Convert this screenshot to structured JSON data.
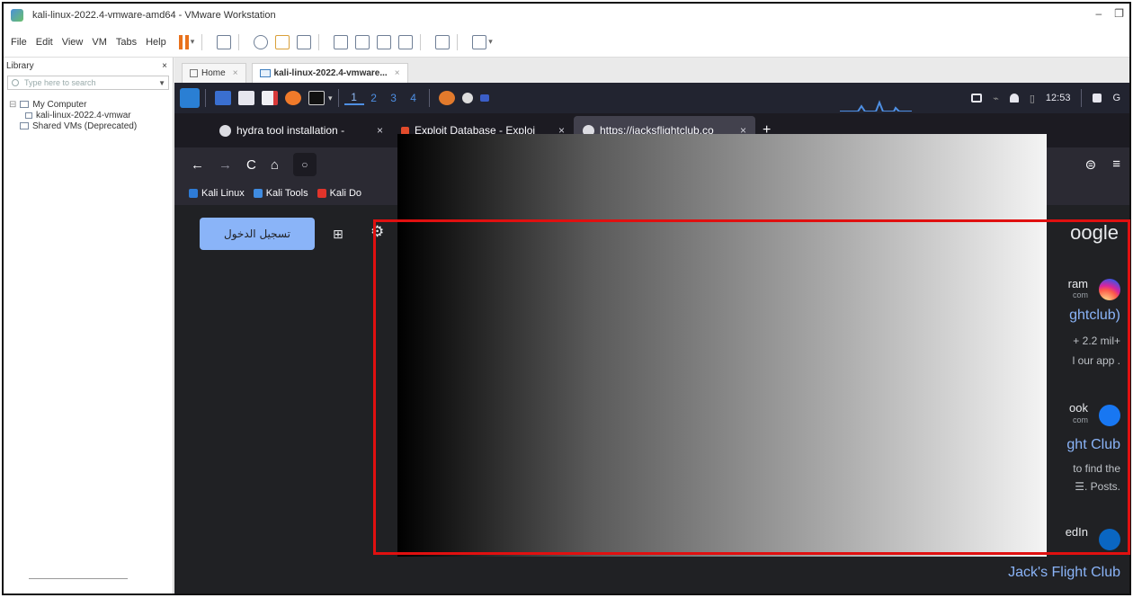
{
  "window": {
    "title": "kali-linux-2022.4-vmware-amd64 - VMware Workstation",
    "controls": [
      "–",
      "❐"
    ]
  },
  "menu": [
    "File",
    "Edit",
    "View",
    "VM",
    "Tabs",
    "Help"
  ],
  "library": {
    "heading": "Library",
    "close": "×",
    "search_placeholder": "Type here to search",
    "tree": {
      "my_computer": "My Computer",
      "vm": "kali-linux-2022.4-vmwar",
      "shared": "Shared VMs (Deprecated)"
    }
  },
  "vm_tabs": [
    {
      "label": "Home",
      "close": "×"
    },
    {
      "label": "kali-linux-2022.4-vmware...",
      "close": "×"
    }
  ],
  "kali_panel": {
    "workspaces": [
      "1",
      "2",
      "3",
      "4"
    ],
    "clock": "12:53"
  },
  "browser_tabs": [
    {
      "title": "hydra tool installation - ",
      "close": "×",
      "color": "#dcdce2"
    },
    {
      "title": "Exploit Database - Exploi",
      "close": "×",
      "color": "#e24b2b"
    },
    {
      "title": "https://jacksflightclub.co",
      "close": "×",
      "color": "#dcdce2"
    }
  ],
  "new_tab": "+",
  "nav": {
    "back": "←",
    "forward": "→",
    "reload": "C",
    "home": "⌂",
    "url_icon": "○",
    "right_icons": [
      "⊜",
      "≡"
    ]
  },
  "bookmarks": [
    {
      "label": "Kali Linux",
      "color": "#2e7bd6"
    },
    {
      "label": "Kali Tools",
      "color": "#3f8be0"
    },
    {
      "label": "Kali Do",
      "color": "#e0342b"
    }
  ],
  "page": {
    "signin": "تسجيل الدخول",
    "apps_icon": "⊞",
    "gear_icon": "⚙",
    "google_partial": "oogle",
    "results": {
      "instagram_name": "ram",
      "instagram_url": "com",
      "instagram_title": "ghtclub)",
      "instagram_meta": "+ 2.2 mil+",
      "instagram_snip": "l our app .",
      "facebook_name": "ook",
      "facebook_url": "com",
      "facebook_title": "ght Club",
      "facebook_snip1": "to find the",
      "facebook_snip2": "☰. Posts.",
      "linkedin_name": "edIn",
      "bottom_title": "Jack's Flight Club"
    }
  },
  "colors": {
    "highlight_box": "#e01010",
    "search_button": "#8ab4f8",
    "instagram": "#d6249f",
    "facebook": "#1877f2",
    "linkedin": "#0a66c2"
  }
}
